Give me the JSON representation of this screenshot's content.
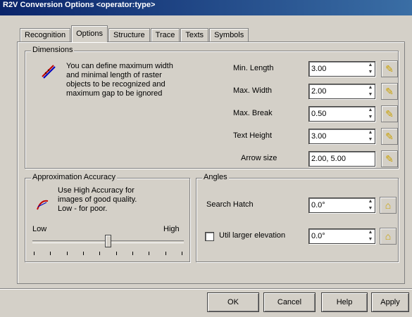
{
  "window": {
    "title": "R2V Conversion Options <operator:type>"
  },
  "tabs": [
    {
      "label": "Recognition"
    },
    {
      "label": "Options"
    },
    {
      "label": "Structure"
    },
    {
      "label": "Trace"
    },
    {
      "label": "Texts"
    },
    {
      "label": "Symbols"
    }
  ],
  "dimensions": {
    "legend": "Dimensions",
    "description": "You can define maximum width\nand minimal length of raster\nobjects to be recognized and\nmaximum gap to be ignored",
    "fields": [
      {
        "label": "Min. Length",
        "value": "3.00"
      },
      {
        "label": "Max. Width",
        "value": "2.00"
      },
      {
        "label": "Max. Break",
        "value": "0.50"
      },
      {
        "label": "Text Height",
        "value": "3.00"
      },
      {
        "label": "Arrow size",
        "value": "2.00, 5.00"
      }
    ]
  },
  "approximation": {
    "legend": "Approximation Accuracy",
    "description": "Use High Accuracy  for\nimages of good quality.\nLow - for poor.",
    "low_label": "Low",
    "high_label": "High",
    "level": 0.5
  },
  "angles": {
    "legend": "Angles",
    "snap_label": "Search Hatch",
    "snap_value": "0.0°",
    "checkbox_label": "Util larger elevation",
    "checkbox_value": "0.0°",
    "checked": false
  },
  "buttons": {
    "ok": "OK",
    "cancel": "Cancel",
    "help": "Help",
    "apply": "Apply"
  },
  "colors": {
    "dialog_bg": "#d4d0c8",
    "titlebar": "#0a246a",
    "reset_icon": "#c9a100"
  }
}
